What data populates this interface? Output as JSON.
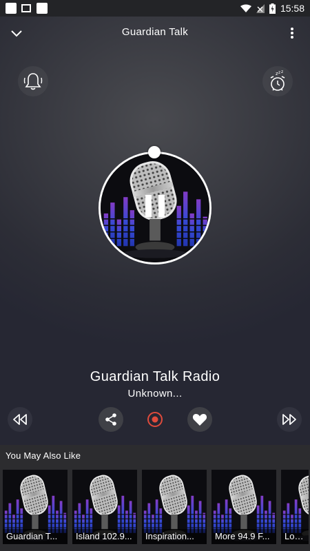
{
  "status": {
    "time": "15:58"
  },
  "header": {
    "title": "Guardian Talk"
  },
  "now_playing": {
    "station": "Guardian Talk Radio",
    "subtitle": "Unknown..."
  },
  "icons": {
    "collapse": "chevron-down-icon",
    "menu": "more-vert-icon",
    "notification": "bell-icon",
    "sleep_timer": "alarm-clock-icon",
    "prev": "rewind-icon",
    "next": "fast-forward-icon",
    "share": "share-icon",
    "record": "record-icon",
    "favorite": "heart-icon",
    "playback": "pause-icon"
  },
  "colors": {
    "accent_record": "#e04b3c",
    "bars": "#3d46c9"
  },
  "similar": {
    "heading": "You May Also Like",
    "items": [
      {
        "label": "Guardian T..."
      },
      {
        "label": "Island 102.9..."
      },
      {
        "label": "Inspiration..."
      },
      {
        "label": "More 94.9 F..."
      },
      {
        "label": "Love R"
      }
    ]
  }
}
